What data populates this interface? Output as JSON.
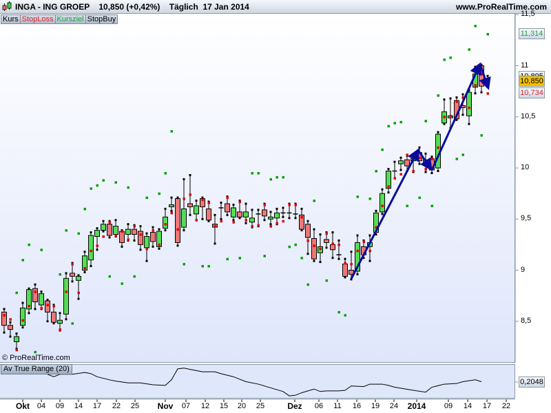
{
  "title": {
    "symbol": "INGA - ING GROEP",
    "price_change": "10,850 (+0,42%)",
    "period": "Täglich",
    "date": "17 Jan 2014",
    "site": "www.ProRealTime.com"
  },
  "tabs": [
    {
      "label": "Kurs",
      "color": "#000000"
    },
    {
      "label": "StopLoss",
      "color": "#e0202a"
    },
    {
      "label": "Kursziel",
      "color": "#20a040"
    },
    {
      "label": "StopBuy",
      "color": "#000000"
    }
  ],
  "copyright": "© ProRealTime.com",
  "colors": {
    "up": "#55dd55",
    "down": "#ee7777",
    "stoploss": "#dd0000",
    "kursziel": "#00a000",
    "drawing": "#0a0a9a"
  },
  "price_axis": {
    "ticks": [
      {
        "label": "11,5",
        "value": 11.5
      },
      {
        "label": "11",
        "value": 11.0
      },
      {
        "label": "10,5",
        "value": 10.5
      },
      {
        "label": "10",
        "value": 10.0
      },
      {
        "label": "9,5",
        "value": 9.5
      },
      {
        "label": "9",
        "value": 9.0
      },
      {
        "label": "8,5",
        "value": 8.5
      }
    ],
    "boxes": [
      {
        "label": "11,314",
        "value": 11.314,
        "color": "#20a040",
        "bg": ""
      },
      {
        "label": "10,895",
        "value": 10.895,
        "color": "#000000",
        "bg": ""
      },
      {
        "label": "10,850",
        "value": 10.85,
        "color": "#000000",
        "bg": "#f5c000"
      },
      {
        "label": "10,734",
        "value": 10.734,
        "color": "#e0202a",
        "bg": ""
      }
    ]
  },
  "atr": {
    "label": "Av True Range (20)",
    "value_label": "0,2048",
    "value": 0.2048
  },
  "date_axis": [
    "Okt",
    "04",
    "09",
    "14",
    "17",
    "22",
    "25",
    "Nov",
    "07",
    "12",
    "15",
    "20",
    "25",
    "Dez",
    "06",
    "11",
    "16",
    "19",
    "24",
    "2014",
    "09",
    "14",
    "17",
    "22"
  ],
  "date_axis_major": [
    "Okt",
    "Nov",
    "Dez",
    "2014"
  ],
  "chart_data": {
    "type": "candlestick",
    "title": "INGA - ING GROEP Täglich",
    "ylim": [
      8.15,
      11.65
    ],
    "ohlc": [
      [
        8.59,
        8.61,
        8.4,
        8.46
      ],
      [
        8.46,
        8.48,
        8.36,
        8.42
      ],
      [
        8.3,
        8.37,
        8.24,
        8.35
      ],
      [
        8.46,
        8.67,
        8.45,
        8.63
      ],
      [
        8.62,
        8.81,
        8.59,
        8.81
      ],
      [
        8.82,
        8.85,
        8.63,
        8.69
      ],
      [
        8.66,
        8.78,
        8.63,
        8.77
      ],
      [
        8.7,
        8.7,
        8.51,
        8.59
      ],
      [
        8.59,
        8.65,
        8.49,
        8.49
      ],
      [
        8.48,
        8.57,
        8.42,
        8.51
      ],
      [
        8.57,
        8.96,
        8.53,
        8.92
      ],
      [
        8.97,
        9.06,
        8.9,
        8.94
      ],
      [
        8.9,
        8.94,
        8.73,
        8.94
      ],
      [
        9.0,
        9.17,
        8.99,
        9.14
      ],
      [
        9.1,
        9.36,
        9.05,
        9.34
      ],
      [
        9.33,
        9.4,
        9.21,
        9.39
      ],
      [
        9.39,
        9.47,
        9.39,
        9.45
      ],
      [
        9.45,
        9.47,
        9.33,
        9.34
      ],
      [
        9.35,
        9.48,
        9.34,
        9.43
      ],
      [
        9.38,
        9.38,
        9.24,
        9.27
      ],
      [
        9.35,
        9.44,
        9.3,
        9.4
      ],
      [
        9.4,
        9.43,
        9.3,
        9.35
      ],
      [
        9.38,
        9.42,
        9.21,
        9.25
      ],
      [
        9.22,
        9.35,
        9.1,
        9.33
      ],
      [
        9.37,
        9.41,
        9.24,
        9.28
      ],
      [
        9.23,
        9.39,
        9.22,
        9.38
      ],
      [
        9.41,
        9.59,
        9.4,
        9.52
      ],
      [
        9.62,
        9.7,
        9.59,
        9.64
      ],
      [
        9.7,
        9.7,
        9.25,
        9.27
      ],
      [
        9.42,
        9.88,
        9.4,
        9.6
      ],
      [
        9.65,
        9.92,
        9.55,
        9.62
      ],
      [
        9.55,
        9.67,
        9.5,
        9.63
      ],
      [
        9.7,
        9.7,
        9.51,
        9.62
      ],
      [
        9.6,
        9.66,
        9.49,
        9.49
      ],
      [
        9.45,
        9.53,
        9.27,
        9.42
      ],
      [
        9.6,
        9.65,
        9.51,
        9.61
      ],
      [
        9.65,
        9.71,
        9.55,
        9.57
      ],
      [
        9.52,
        9.63,
        9.5,
        9.61
      ],
      [
        9.57,
        9.67,
        9.52,
        9.52
      ],
      [
        9.52,
        9.64,
        9.47,
        9.57
      ],
      [
        9.47,
        9.58,
        9.43,
        9.51
      ],
      [
        9.55,
        9.58,
        9.44,
        9.55
      ],
      [
        9.59,
        9.64,
        9.5,
        9.53
      ],
      [
        9.5,
        9.56,
        9.46,
        9.52
      ],
      [
        9.51,
        9.59,
        9.46,
        9.56
      ],
      [
        9.56,
        9.6,
        9.53,
        9.55
      ],
      [
        9.56,
        9.64,
        9.52,
        9.56
      ],
      [
        9.55,
        9.64,
        9.52,
        9.54
      ],
      [
        9.54,
        9.59,
        9.4,
        9.4
      ],
      [
        9.45,
        9.47,
        9.17,
        9.32
      ],
      [
        9.31,
        9.39,
        9.1,
        9.11
      ],
      [
        9.17,
        9.34,
        9.09,
        9.23
      ],
      [
        9.3,
        9.36,
        9.23,
        9.27
      ],
      [
        9.25,
        9.36,
        9.13,
        9.2
      ],
      [
        9.15,
        9.28,
        9.12,
        9.14
      ],
      [
        9.06,
        9.1,
        8.94,
        8.94
      ],
      [
        9.0,
        9.17,
        8.92,
        8.96
      ],
      [
        8.99,
        9.33,
        8.97,
        9.27
      ],
      [
        9.23,
        9.28,
        9.13,
        9.15
      ],
      [
        9.23,
        9.33,
        9.1,
        9.27
      ],
      [
        9.37,
        9.57,
        9.36,
        9.56
      ],
      [
        9.57,
        9.78,
        9.56,
        9.75
      ],
      [
        9.8,
        9.98,
        9.77,
        9.97
      ],
      [
        9.97,
        10.05,
        9.91,
        9.97
      ],
      [
        10.04,
        10.09,
        9.99,
        10.07
      ],
      [
        10.08,
        10.11,
        9.98,
        10.02
      ],
      [
        10.07,
        10.1,
        9.97,
        10.09
      ],
      [
        10.15,
        10.19,
        10.05,
        10.07
      ],
      [
        10.06,
        10.13,
        9.97,
        10.08
      ],
      [
        10.09,
        10.1,
        9.96,
        9.98
      ],
      [
        10.0,
        10.34,
        9.98,
        10.33
      ],
      [
        10.44,
        10.66,
        10.44,
        10.55
      ],
      [
        10.49,
        10.67,
        10.4,
        10.51
      ],
      [
        10.66,
        10.68,
        10.48,
        10.48
      ],
      [
        10.61,
        10.71,
        10.53,
        10.59
      ],
      [
        10.51,
        10.75,
        10.44,
        10.74
      ],
      [
        10.79,
        10.98,
        10.74,
        10.92
      ],
      [
        11.0,
        11.0,
        10.75,
        10.8
      ],
      [
        10.84,
        10.89,
        10.8,
        10.85
      ]
    ],
    "stoploss": [
      8.56,
      8.52,
      8.22,
      8.51,
      8.65,
      8.79,
      8.63,
      8.66,
      8.65,
      8.42,
      8.79,
      9.06,
      8.78,
      9.02,
      9.19,
      9.24,
      9.33,
      9.47,
      9.34,
      9.38,
      9.3,
      9.43,
      9.35,
      9.21,
      9.39,
      9.25,
      9.45,
      9.56,
      9.4,
      9.7,
      9.74,
      9.49,
      9.69,
      9.66,
      9.43,
      9.48,
      9.71,
      9.47,
      9.67,
      9.49,
      9.43,
      9.44,
      9.64,
      9.43,
      9.46,
      9.48,
      9.64,
      9.64,
      9.52,
      9.29,
      9.24,
      9.21,
      9.36,
      9.26,
      9.25,
      9.07,
      9.06,
      9.19,
      9.28,
      9.19,
      9.42,
      9.63,
      9.82,
      9.9,
      9.94,
      10.13,
      9.97,
      10.1,
      9.99,
      10.09,
      10.2,
      10.5,
      10.51,
      10.65,
      10.69,
      10.59,
      10.81,
      10.92,
      10.73
    ],
    "kursziel": [
      [
        3,
        8.78
      ],
      [
        4,
        9.1
      ],
      [
        5,
        9.25
      ],
      [
        6,
        8.2
      ],
      [
        7,
        9.2
      ],
      [
        10,
        8.96
      ],
      [
        11,
        9.39
      ],
      [
        12,
        8.48
      ],
      [
        13,
        9.36
      ],
      [
        14,
        9.6
      ],
      [
        15,
        9.8
      ],
      [
        16,
        9.83
      ],
      [
        17,
        9.88
      ],
      [
        18,
        8.94
      ],
      [
        19,
        9.86
      ],
      [
        20,
        8.87
      ],
      [
        21,
        9.81
      ],
      [
        22,
        8.94
      ],
      [
        24,
        9.71
      ],
      [
        26,
        9.75
      ],
      [
        27,
        9.95
      ],
      [
        28,
        10.36
      ],
      [
        30,
        9.06
      ],
      [
        33,
        9.04
      ],
      [
        34,
        9.04
      ],
      [
        37,
        9.11
      ],
      [
        39,
        9.12
      ],
      [
        41,
        9.95
      ],
      [
        42,
        9.95
      ],
      [
        43,
        9.14
      ],
      [
        44,
        9.89
      ],
      [
        45,
        9.91
      ],
      [
        46,
        9.91
      ],
      [
        47,
        9.23
      ],
      [
        48,
        9.25
      ],
      [
        49,
        9.12
      ],
      [
        50,
        8.86
      ],
      [
        51,
        9.68
      ],
      [
        53,
        8.9
      ],
      [
        55,
        8.59
      ],
      [
        56,
        8.56
      ],
      [
        58,
        9.72
      ],
      [
        60,
        9.7
      ],
      [
        61,
        9.97
      ],
      [
        62,
        10.18
      ],
      [
        63,
        10.41
      ],
      [
        64,
        10.44
      ],
      [
        65,
        10.45
      ],
      [
        66,
        9.63
      ],
      [
        68,
        9.71
      ],
      [
        70,
        9.63
      ],
      [
        69,
        10.46
      ],
      [
        71,
        10.71
      ],
      [
        72,
        11.06
      ],
      [
        73,
        11.08
      ],
      [
        74,
        10.09
      ],
      [
        75,
        10.13
      ],
      [
        76,
        11.16
      ],
      [
        77,
        11.39
      ],
      [
        78,
        10.32
      ],
      [
        79,
        11.31
      ]
    ],
    "atr_series": [
      [
        8,
        0.2216
      ],
      [
        9,
        0.216
      ],
      [
        10,
        0.2216
      ],
      [
        12,
        0.2216
      ],
      [
        14,
        0.2258
      ],
      [
        15,
        0.223
      ],
      [
        16,
        0.216
      ],
      [
        18,
        0.209
      ],
      [
        19,
        0.2062
      ],
      [
        21,
        0.202
      ],
      [
        23,
        0.202
      ],
      [
        25,
        0.1978
      ],
      [
        27,
        0.1964
      ],
      [
        28,
        0.209
      ],
      [
        29,
        0.234
      ],
      [
        30,
        0.2356
      ],
      [
        31,
        0.2328
      ],
      [
        32,
        0.23
      ],
      [
        33,
        0.2272
      ],
      [
        35,
        0.2272
      ],
      [
        36,
        0.223
      ],
      [
        38,
        0.216
      ],
      [
        39,
        0.2104
      ],
      [
        40,
        0.2048
      ],
      [
        42,
        0.1992
      ],
      [
        44,
        0.1908
      ],
      [
        46,
        0.1824
      ],
      [
        47,
        0.1726
      ],
      [
        48,
        0.174
      ],
      [
        49,
        0.1796
      ],
      [
        51,
        0.188
      ],
      [
        52,
        0.1824
      ],
      [
        53,
        0.1838
      ],
      [
        55,
        0.1838
      ],
      [
        56,
        0.1852
      ],
      [
        57,
        0.195
      ],
      [
        59,
        0.1936
      ],
      [
        60,
        0.1992
      ],
      [
        62,
        0.1992
      ],
      [
        63,
        0.1964
      ],
      [
        64,
        0.1922
      ],
      [
        67,
        0.1852
      ],
      [
        69,
        0.181
      ],
      [
        70,
        0.1922
      ],
      [
        72,
        0.1992
      ],
      [
        74,
        0.2006
      ],
      [
        75,
        0.2048
      ],
      [
        77,
        0.209
      ],
      [
        78,
        0.2048
      ]
    ],
    "atr_ylim": [
      0.168,
      0.24
    ]
  }
}
